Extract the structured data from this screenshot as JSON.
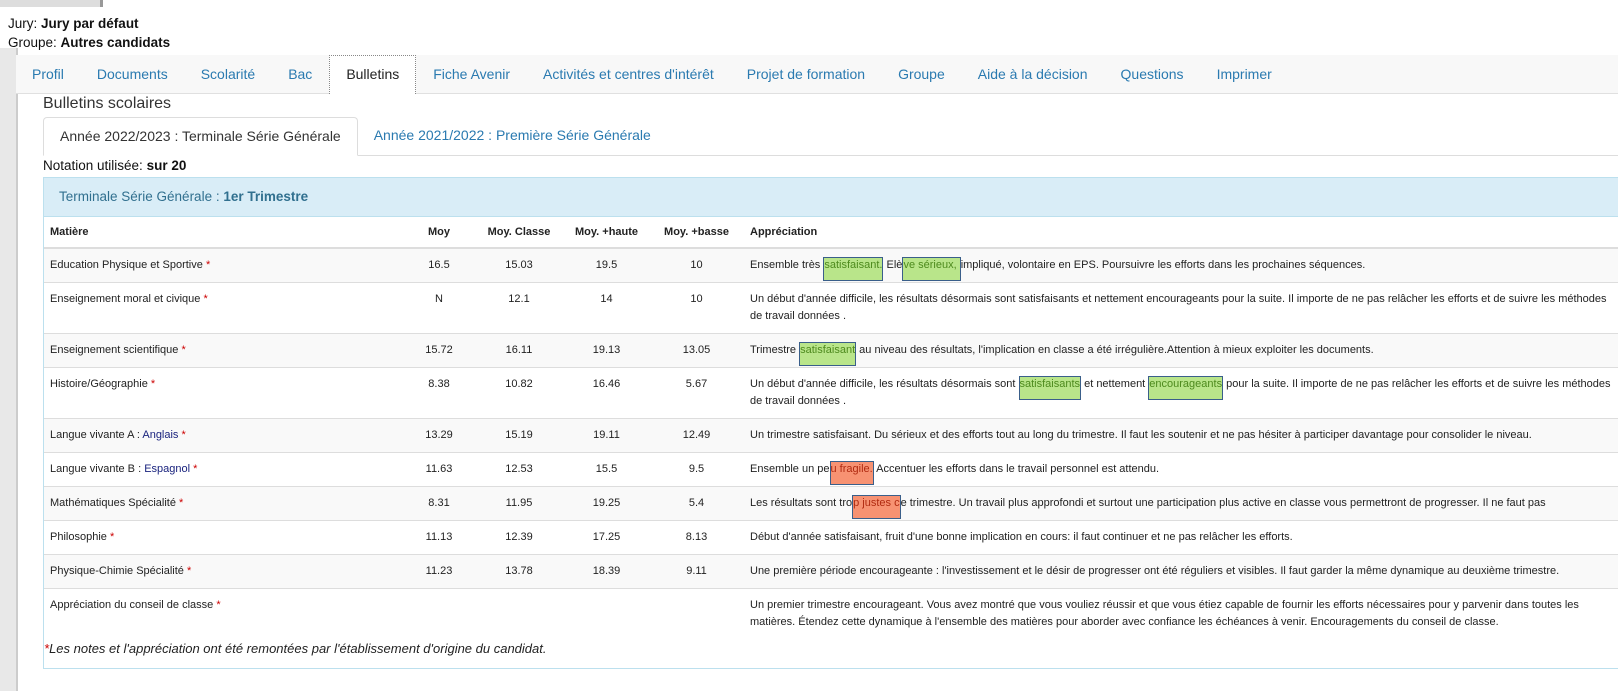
{
  "header": {
    "jury_label": "Jury:",
    "jury_value": "Jury par défaut",
    "groupe_label": "Groupe:",
    "groupe_value": "Autres candidats"
  },
  "nav_tabs": [
    "Profil",
    "Documents",
    "Scolarité",
    "Bac",
    "Bulletins",
    "Fiche Avenir",
    "Activités et centres d'intérêt",
    "Projet de formation",
    "Groupe",
    "Aide à la décision",
    "Questions",
    "Imprimer"
  ],
  "active_nav_tab": "Bulletins",
  "section_title": "Bulletins scolaires",
  "year_tabs": [
    "Année 2022/2023 : Terminale Série Générale",
    "Année 2021/2022 : Première Série Générale"
  ],
  "notation": {
    "label": "Notation utilisée:",
    "value": "sur 20"
  },
  "panel": {
    "class": "Terminale Série Générale :",
    "period": "1er Trimestre"
  },
  "columns": [
    "Matière",
    "Moy",
    "Moy. Classe",
    "Moy. +haute",
    "Moy. +basse",
    "Appréciation"
  ],
  "rows": [
    {
      "subject": "Education Physique et Sportive",
      "moy": "16.5",
      "classe": "15.03",
      "haute": "19.5",
      "basse": "10",
      "appreciation": [
        {
          "t": "Ensemble très "
        },
        {
          "t": "satisfaisant.",
          "hl": "green"
        },
        {
          "t": " Elè"
        },
        {
          "t": "ve sérieux, ",
          "hl": "green"
        },
        {
          "t": " impliqué, volontaire en EPS. Poursuivre les efforts dans les prochaines séquences."
        }
      ]
    },
    {
      "subject": "Enseignement moral et civique",
      "moy": "N",
      "classe": "12.1",
      "haute": "14",
      "basse": "10",
      "appreciation": [
        {
          "t": "Un début d'année difficile, les résultats désormais sont satisfaisants et nettement encourageants pour la suite. Il importe de ne pas relâcher les efforts et de suivre les méthodes de travail données ."
        }
      ]
    },
    {
      "subject": "Enseignement scientifique",
      "moy": "15.72",
      "classe": "16.11",
      "haute": "19.13",
      "basse": "13.05",
      "appreciation": [
        {
          "t": "Trimestre "
        },
        {
          "t": "satisfaisant",
          "hl": "green"
        },
        {
          "t": " au niveau des résultats, l'implication en classe a été irrégulière.Attention à mieux exploiter les documents."
        }
      ]
    },
    {
      "subject": "Histoire/Géographie",
      "moy": "8.38",
      "classe": "10.82",
      "haute": "16.46",
      "basse": "5.67",
      "appreciation": [
        {
          "t": "Un début d'année difficile, les résultats désormais sont "
        },
        {
          "t": "satisfaisants",
          "hl": "green"
        },
        {
          "t": " et nettement "
        },
        {
          "t": "encourageants",
          "hl": "green"
        },
        {
          "t": " pour la suite. Il importe de ne pas relâcher les efforts et de suivre les méthodes de travail données ."
        }
      ]
    },
    {
      "subject": "Langue vivante A : ",
      "lang": "Anglais",
      "moy": "13.29",
      "classe": "15.19",
      "haute": "19.11",
      "basse": "12.49",
      "appreciation": [
        {
          "t": "Un trimestre satisfaisant. Du sérieux et des efforts tout au long du trimestre. Il faut les soutenir et ne pas hésiter à participer davantage pour consolider le niveau."
        }
      ]
    },
    {
      "subject": "Langue vivante B : ",
      "lang": "Espagnol",
      "moy": "11.63",
      "classe": "12.53",
      "haute": "15.5",
      "basse": "9.5",
      "appreciation": [
        {
          "t": "Ensemble un pe"
        },
        {
          "t": "u fragile.",
          "hl": "red"
        },
        {
          "t": " Accentuer les efforts dans le travail personnel est attendu."
        }
      ]
    },
    {
      "subject": "Mathématiques Spécialité",
      "moy": "8.31",
      "classe": "11.95",
      "haute": "19.25",
      "basse": "5.4",
      "appreciation": [
        {
          "t": "Les résultats sont tro"
        },
        {
          "t": "p justes c",
          "hl": "red"
        },
        {
          "t": "e trimestre. Un travail plus approfondi et surtout une participation plus active en classe vous permettront de progresser. Il ne faut pas"
        }
      ]
    },
    {
      "subject": "Philosophie",
      "moy": "11.13",
      "classe": "12.39",
      "haute": "17.25",
      "basse": "8.13",
      "appreciation": [
        {
          "t": "Début d'année satisfaisant, fruit d'une bonne implication en cours: il faut continuer et ne pas relâcher les efforts."
        }
      ]
    },
    {
      "subject": "Physique-Chimie Spécialité",
      "moy": "11.23",
      "classe": "13.78",
      "haute": "18.39",
      "basse": "9.11",
      "appreciation": [
        {
          "t": "Une première période encourageante : l'investissement et le désir de progresser ont été réguliers et visibles. Il faut garder la même dynamique au deuxième trimestre."
        }
      ]
    },
    {
      "subject": "Appréciation du conseil de classe",
      "moy": "",
      "classe": "",
      "haute": "",
      "basse": "",
      "appreciation": [
        {
          "t": "Un premier trimestre encourageant. Vous avez montré que vous vouliez réussir et que vous étiez capable de fournir les efforts nécessaires pour y parvenir dans toutes les matières. Étendez cette dynamique à l'ensemble des matières pour aborder avec confiance les échéances à venir. Encouragements du conseil de classe."
        }
      ]
    }
  ],
  "star": "*",
  "footnote": "Les notes et l'appréciation ont été remontées par l'établissement d'origine du candidat.",
  "colors": {
    "link": "#2a7ab0",
    "panel_bg": "#d9edf7",
    "highlight_positive": "#b9e58a",
    "highlight_negative": "#f79272"
  }
}
